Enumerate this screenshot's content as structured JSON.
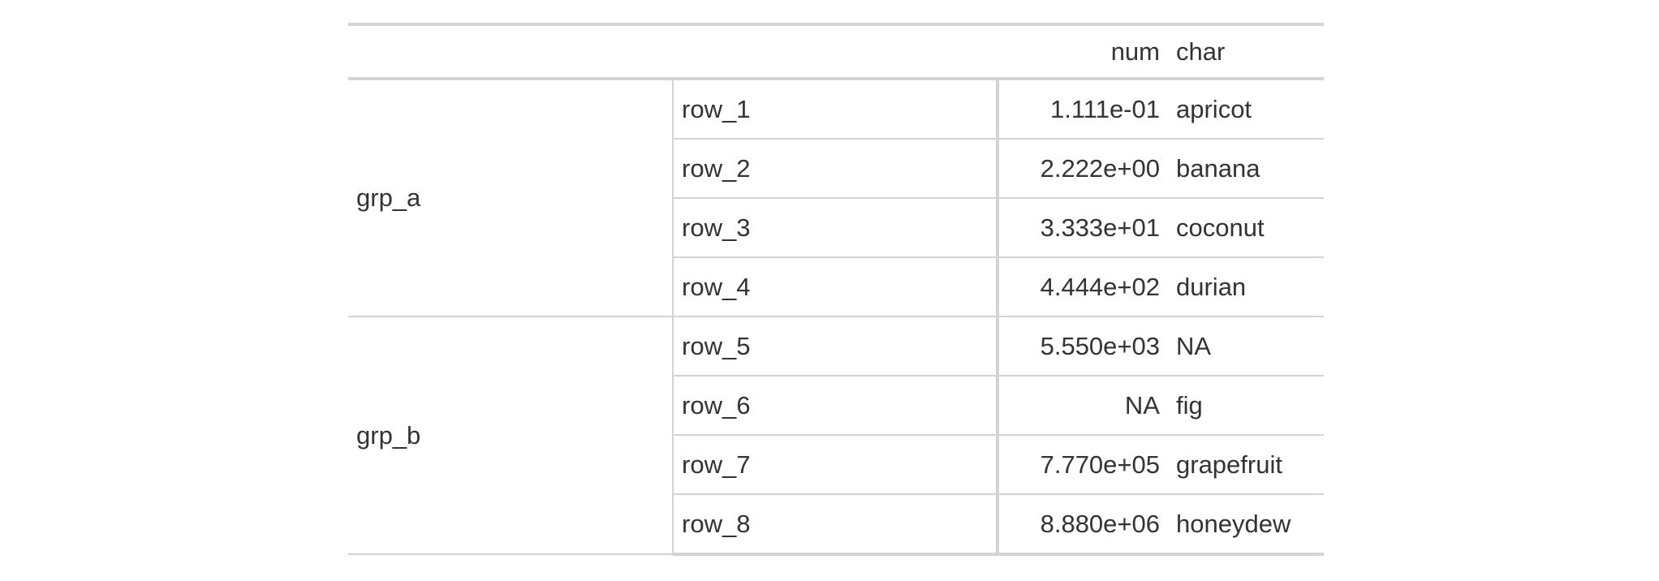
{
  "table": {
    "columns": [
      "",
      "",
      "num",
      "char"
    ],
    "groups": [
      {
        "label": "grp_a",
        "rows": [
          {
            "stub": "row_1",
            "num": "1.111e-01",
            "char": "apricot"
          },
          {
            "stub": "row_2",
            "num": "2.222e+00",
            "char": "banana"
          },
          {
            "stub": "row_3",
            "num": "3.333e+01",
            "char": "coconut"
          },
          {
            "stub": "row_4",
            "num": "4.444e+02",
            "char": "durian"
          }
        ]
      },
      {
        "label": "grp_b",
        "rows": [
          {
            "stub": "row_5",
            "num": "5.550e+03",
            "char": "NA"
          },
          {
            "stub": "row_6",
            "num": "NA",
            "char": "fig"
          },
          {
            "stub": "row_7",
            "num": "7.770e+05",
            "char": "grapefruit"
          },
          {
            "stub": "row_8",
            "num": "8.880e+06",
            "char": "honeydew"
          }
        ]
      }
    ]
  }
}
